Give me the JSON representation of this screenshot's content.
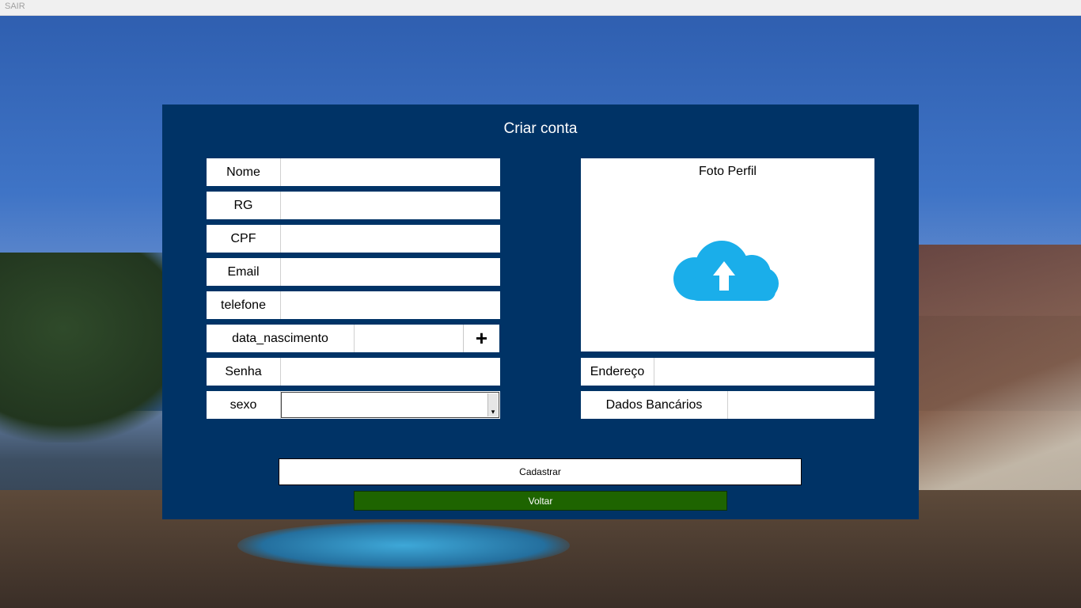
{
  "titlebar": {
    "exit_label": "SAIR"
  },
  "form": {
    "title": "Criar conta",
    "fields": {
      "nome": {
        "label": "Nome",
        "value": ""
      },
      "rg": {
        "label": "RG",
        "value": ""
      },
      "cpf": {
        "label": "CPF",
        "value": ""
      },
      "email": {
        "label": "Email",
        "value": ""
      },
      "telefone": {
        "label": "telefone",
        "value": ""
      },
      "data_nascimento": {
        "label": "data_nascimento",
        "value": "",
        "button": "+"
      },
      "senha": {
        "label": "Senha",
        "value": ""
      },
      "sexo": {
        "label": "sexo",
        "value": ""
      },
      "endereco": {
        "label": "Endereço",
        "value": ""
      },
      "dados_bancarios": {
        "label": "Dados Bancários",
        "value": ""
      }
    },
    "photo": {
      "title": "Foto Perfil",
      "icon": "cloud-upload-icon",
      "icon_color": "#1aaeea"
    },
    "buttons": {
      "cadastrar": "Cadastrar",
      "voltar": "Voltar"
    }
  },
  "colors": {
    "panel": "#003366",
    "voltar_button": "#1e6400"
  }
}
